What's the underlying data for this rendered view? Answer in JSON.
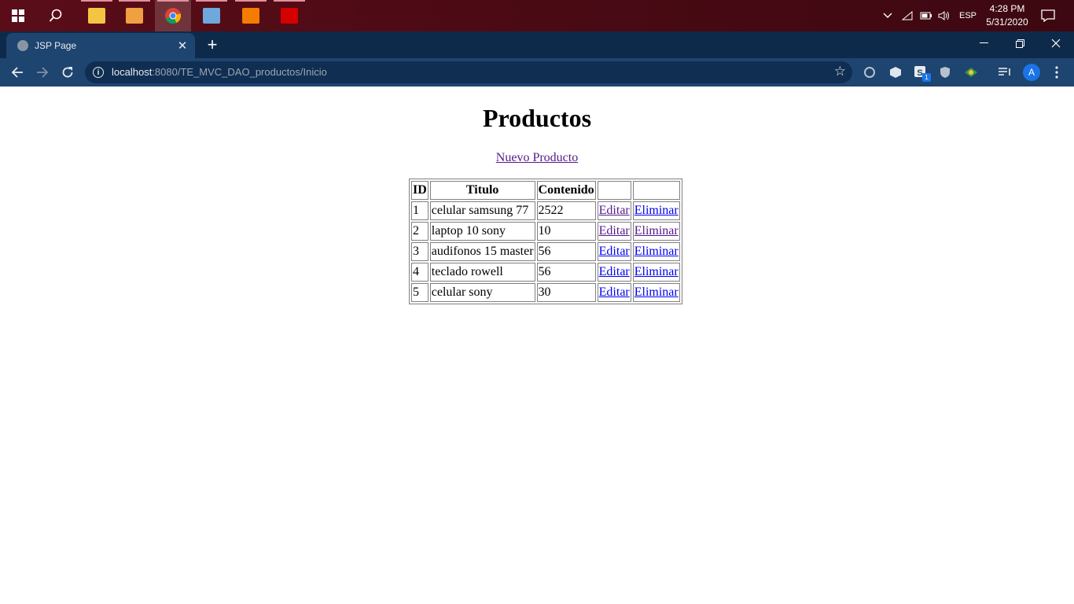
{
  "taskbar": {
    "apps": [
      {
        "name": "file-explorer",
        "color": "#f4c542"
      },
      {
        "name": "media-player",
        "color": "#f0a040"
      },
      {
        "name": "chrome",
        "color": "#4caf50"
      },
      {
        "name": "virtualbox",
        "color": "#6fa8dc"
      },
      {
        "name": "xampp",
        "color": "#f57c00"
      },
      {
        "name": "acrobat",
        "color": "#d50000"
      }
    ],
    "language": "ESP",
    "time": "4:28 PM",
    "date": "5/31/2020"
  },
  "browser": {
    "tab_title": "JSP Page",
    "url_host": "localhost",
    "url_path": ":8080/TE_MVC_DAO_productos/Inicio",
    "avatar_letter": "A",
    "extension_badge": "1"
  },
  "page": {
    "title": "Productos",
    "new_product_link": "Nuevo Producto",
    "table": {
      "headers": [
        "ID",
        "Titulo",
        "Contenido",
        "",
        ""
      ],
      "rows": [
        {
          "id": "1",
          "titulo": "celular samsung 77",
          "contenido": "2522",
          "edit": "Editar",
          "delete": "Eliminar"
        },
        {
          "id": "2",
          "titulo": "laptop 10 sony",
          "contenido": "10",
          "edit": "Editar",
          "delete": "Eliminar"
        },
        {
          "id": "3",
          "titulo": "audifonos 15 master",
          "contenido": "56",
          "edit": "Editar",
          "delete": "Eliminar"
        },
        {
          "id": "4",
          "titulo": "teclado rowell",
          "contenido": "56",
          "edit": "Editar",
          "delete": "Eliminar"
        },
        {
          "id": "5",
          "titulo": "celular sony",
          "contenido": "30",
          "edit": "Editar",
          "delete": "Eliminar"
        }
      ]
    }
  }
}
